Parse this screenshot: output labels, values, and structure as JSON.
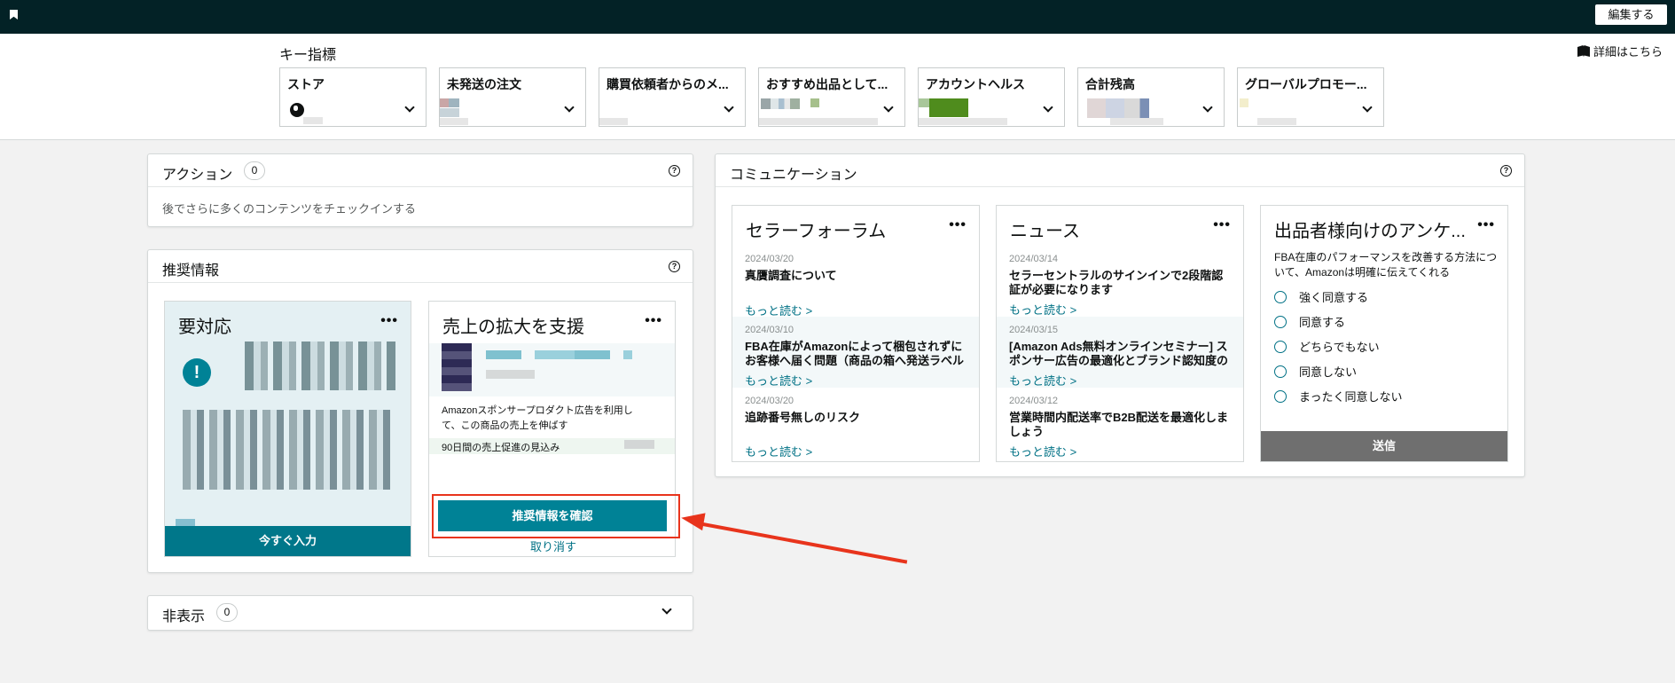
{
  "topbar": {
    "edit_label": "編集する"
  },
  "metrics": {
    "title": "キー指標",
    "details_label": "詳細はこちら",
    "cards": [
      {
        "title": "ストア"
      },
      {
        "title": "未発送の注文"
      },
      {
        "title": "購買依頼者からのメ..."
      },
      {
        "title": "おすすめ出品として..."
      },
      {
        "title": "アカウントヘルス"
      },
      {
        "title": "合計残高"
      },
      {
        "title": "グローバルプロモー..."
      }
    ]
  },
  "actions": {
    "title": "アクション",
    "count": "0",
    "empty_text": "後でさらに多くのコンテンツをチェックインする"
  },
  "recommendations": {
    "title": "推奨情報",
    "action_card": {
      "title": "要対応",
      "button_label": "今すぐ入力"
    },
    "growth_card": {
      "title": "売上の拡大を支援",
      "description": "Amazonスポンサープロダクト広告を利用して、この商品の売上を伸ばす",
      "estimate_label": "90日間の売上促進の見込み",
      "confirm_label": "推奨情報を確認",
      "dismiss_label": "取り消す"
    }
  },
  "hidden": {
    "title": "非表示",
    "count": "0"
  },
  "communications": {
    "title": "コミュニケーション",
    "forum": {
      "title": "セラーフォーラム",
      "items": [
        {
          "date": "2024/03/20",
          "text": "真贋調査について",
          "more": "もっと読む >"
        },
        {
          "date": "2024/03/10",
          "text": "FBA在庫がAmazonによって梱包されずにお客様へ届く問題（商品の箱へ発送ラベル",
          "more": "もっと読む >"
        },
        {
          "date": "2024/03/20",
          "text": "追跡番号無しのリスク",
          "more": "もっと読む >"
        }
      ]
    },
    "news": {
      "title": "ニュース",
      "items": [
        {
          "date": "2024/03/14",
          "text": "セラーセントラルのサインインで2段階認証が必要になります",
          "more": "もっと読む >"
        },
        {
          "date": "2024/03/15",
          "text": "[Amazon Ads無料オンラインセミナー] スポンサー広告の最適化とブランド認知度の",
          "more": "もっと読む >"
        },
        {
          "date": "2024/03/12",
          "text": "営業時間内配送率でB2B配送を最適化しましょう",
          "more": "もっと読む >"
        }
      ]
    },
    "survey": {
      "title": "出品者様向けのアンケ...",
      "question": "FBA在庫のパフォーマンスを改善する方法について、Amazonは明確に伝えてくれる",
      "options": [
        "強く同意する",
        "同意する",
        "どちらでもない",
        "同意しない",
        "まったく同意しない"
      ],
      "submit_label": "送信"
    }
  },
  "colors": {
    "topbar": "#032226",
    "accent": "#007185",
    "button": "#008296",
    "highlight": "#e8341c"
  }
}
